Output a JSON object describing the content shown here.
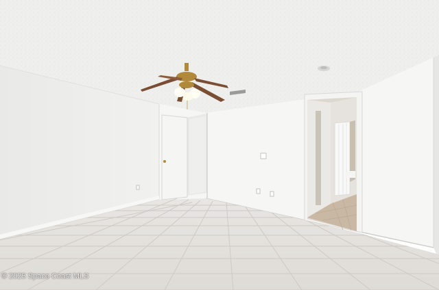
{
  "photo": {
    "subject": "empty bedroom",
    "watermark": "© 2025 Space Coast MLS"
  },
  "colors": {
    "ceiling": "#f1f1ef",
    "wall_left": "#ebebe9",
    "wall_back": "#f6f6f4",
    "floor_tile": "#e3e1dd",
    "grout": "#cfccc7",
    "door": "#f4f4f2",
    "fan_brass": "#b08a3a",
    "fan_blade": "#7a4e33"
  }
}
